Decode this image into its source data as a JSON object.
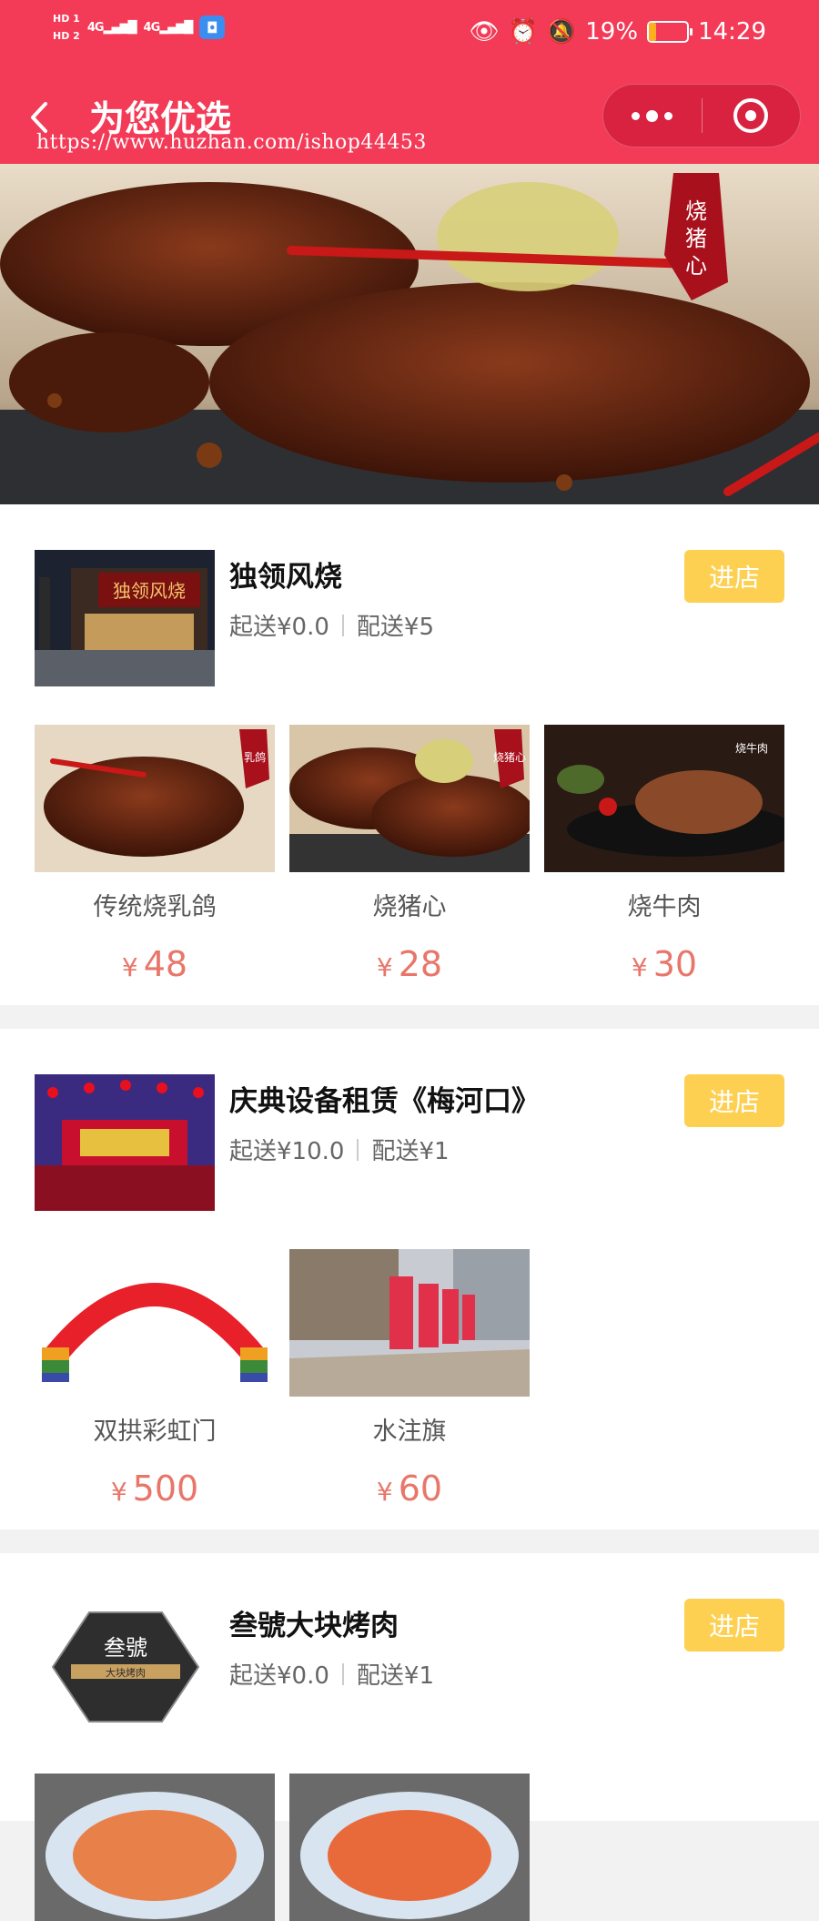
{
  "status_bar": {
    "hd1": "HD 1",
    "hd2": "HD 2",
    "signal1": "4G",
    "signal2": "4G",
    "battery_pct": "19%",
    "battery_level": 0.19,
    "time": "14:29"
  },
  "nav": {
    "title": "为您优选",
    "watermark_url": "https://www.huzhan.com/ishop44453"
  },
  "colors": {
    "brand_red": "#f33a57",
    "button_yellow": "#fdd052",
    "price": "#e8766a"
  },
  "stores": [
    {
      "name": "独领风烧",
      "min_order": "起送¥0.0",
      "delivery_fee": "配送¥5",
      "enter_label": "进店",
      "logo_text": "独领风烧",
      "products": [
        {
          "name": "传统烧乳鸽",
          "currency": "¥",
          "price": "48",
          "tag": "乳鸽"
        },
        {
          "name": "烧猪心",
          "currency": "¥",
          "price": "28",
          "tag": "烧猪心"
        },
        {
          "name": "烧牛肉",
          "currency": "¥",
          "price": "30",
          "tag": "烧牛肉"
        }
      ]
    },
    {
      "name": "庆典设备租赁《梅河口》",
      "min_order": "起送¥10.0",
      "delivery_fee": "配送¥1",
      "enter_label": "进店",
      "products": [
        {
          "name": "双拱彩虹门",
          "currency": "¥",
          "price": "500"
        },
        {
          "name": "水注旗",
          "currency": "¥",
          "price": "60"
        }
      ]
    },
    {
      "name": "叁號大块烤肉",
      "min_order": "起送¥0.0",
      "delivery_fee": "配送¥1",
      "enter_label": "进店",
      "logo_text": "叁號",
      "logo_subtext": "大块烤肉"
    }
  ]
}
